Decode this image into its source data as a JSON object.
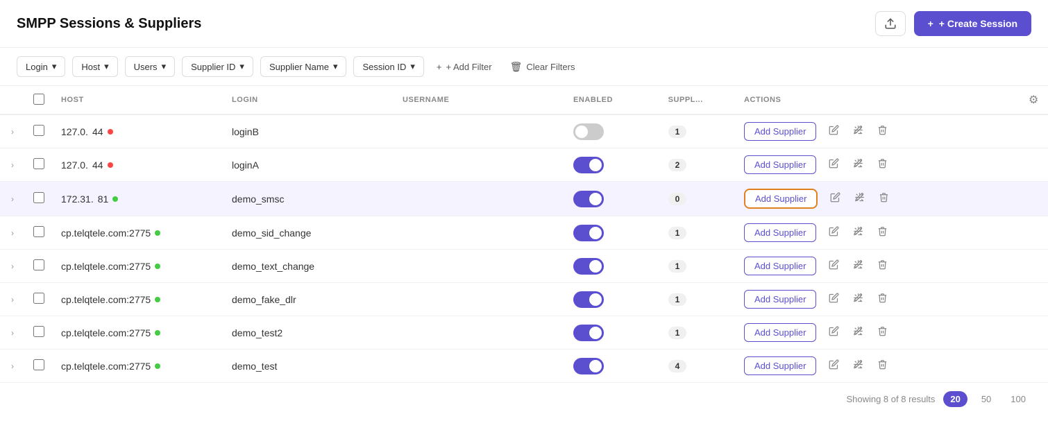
{
  "header": {
    "title": "SMPP Sessions & Suppliers",
    "export_label": "Export",
    "create_label": "+ Create Session"
  },
  "filters": {
    "items": [
      {
        "id": "login",
        "label": "Login"
      },
      {
        "id": "host",
        "label": "Host"
      },
      {
        "id": "users",
        "label": "Users"
      },
      {
        "id": "supplier_id",
        "label": "Supplier ID"
      },
      {
        "id": "supplier_name",
        "label": "Supplier Name"
      },
      {
        "id": "session_id",
        "label": "Session ID"
      }
    ],
    "add_filter_label": "+ Add Filter",
    "clear_filters_label": "Clear Filters"
  },
  "table": {
    "columns": [
      {
        "id": "host",
        "label": "HOST"
      },
      {
        "id": "login",
        "label": "LOGIN"
      },
      {
        "id": "username",
        "label": "USERNAME"
      },
      {
        "id": "enabled",
        "label": "ENABLED"
      },
      {
        "id": "suppl",
        "label": "SUPPL..."
      },
      {
        "id": "actions",
        "label": "ACTIONS"
      }
    ],
    "rows": [
      {
        "id": 1,
        "host": "127.0.",
        "host_num": "44",
        "dot_color": "red",
        "login": "loginB",
        "username": "",
        "enabled": false,
        "suppl_count": "1",
        "highlighted": false
      },
      {
        "id": 2,
        "host": "127.0.",
        "host_num": "44",
        "dot_color": "red",
        "login": "loginA",
        "username": "",
        "enabled": true,
        "suppl_count": "2",
        "highlighted": false
      },
      {
        "id": 3,
        "host": "172.31.",
        "host_num": "81",
        "dot_color": "green",
        "login": "demo_smsc",
        "username": "",
        "enabled": true,
        "suppl_count": "0",
        "highlighted": true
      },
      {
        "id": 4,
        "host": "cp.telqtele.com:2775",
        "host_num": "",
        "dot_color": "green",
        "login": "demo_sid_change",
        "username": "",
        "enabled": true,
        "suppl_count": "1",
        "highlighted": false
      },
      {
        "id": 5,
        "host": "cp.telqtele.com:2775",
        "host_num": "",
        "dot_color": "green",
        "login": "demo_text_change",
        "username": "",
        "enabled": true,
        "suppl_count": "1",
        "highlighted": false
      },
      {
        "id": 6,
        "host": "cp.telqtele.com:2775",
        "host_num": "",
        "dot_color": "green",
        "login": "demo_fake_dlr",
        "username": "",
        "enabled": true,
        "suppl_count": "1",
        "highlighted": false
      },
      {
        "id": 7,
        "host": "cp.telqtele.com:2775",
        "host_num": "",
        "dot_color": "green",
        "login": "demo_test2",
        "username": "",
        "enabled": true,
        "suppl_count": "1",
        "highlighted": false
      },
      {
        "id": 8,
        "host": "cp.telqtele.com:2775",
        "host_num": "",
        "dot_color": "green",
        "login": "demo_test",
        "username": "",
        "enabled": true,
        "suppl_count": "4",
        "highlighted": false
      }
    ],
    "add_supplier_label": "Add Supplier"
  },
  "footer": {
    "showing_text": "Showing 8 of 8 results",
    "page_sizes": [
      "20",
      "50",
      "100"
    ],
    "active_page_size": "20"
  },
  "icons": {
    "chevron_down": "▾",
    "chevron_right": "›",
    "plus": "+",
    "trash": "🗑",
    "edit": "✏",
    "debug": "⚙",
    "settings": "⚙",
    "export": "↑"
  }
}
